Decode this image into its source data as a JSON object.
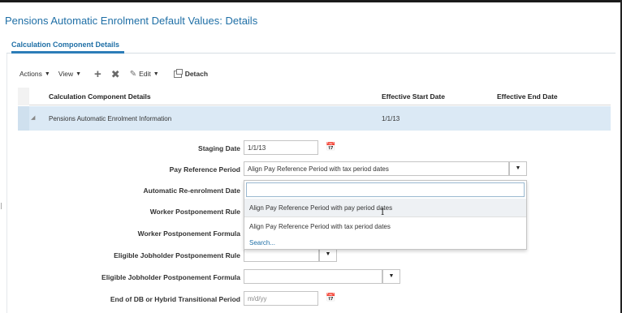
{
  "page": {
    "title": "Pensions Automatic Enrolment Default Values: Details"
  },
  "tabs": [
    {
      "label": "Calculation Component Details",
      "selected": true
    }
  ],
  "toolbar": {
    "actions_label": "Actions",
    "view_label": "View",
    "add_icon": "plus-icon",
    "delete_icon": "x-icon",
    "edit_label": "Edit",
    "detach_label": "Detach"
  },
  "table": {
    "columns": [
      "Calculation Component Details",
      "Effective Start Date",
      "Effective End Date"
    ],
    "rows": [
      {
        "name": "Pensions Automatic Enrolment Information",
        "start": "1/1/13",
        "end": ""
      }
    ]
  },
  "form": {
    "staging_date": {
      "label": "Staging Date",
      "value": "1/1/13"
    },
    "pay_reference_period": {
      "label": "Pay Reference Period",
      "value": "Align Pay Reference Period with tax period dates"
    },
    "auto_reenrolment_date": {
      "label": "Automatic Re-enrolment Date"
    },
    "worker_postponement_rule": {
      "label": "Worker Postponement Rule"
    },
    "worker_postponement_formula": {
      "label": "Worker Postponement Formula"
    },
    "eligible_jobholder_postponement_rule": {
      "label": "Eligible Jobholder Postponement Rule"
    },
    "eligible_jobholder_postponement_formula": {
      "label": "Eligible Jobholder Postponement Formula"
    },
    "end_of_db_hybrid_period": {
      "label": "End of DB or Hybrid Transitional Period",
      "placeholder": "m/d/yy"
    }
  },
  "dropdown": {
    "options": [
      "Align Pay Reference Period with pay period dates",
      "Align Pay Reference Period with tax period dates"
    ],
    "search_label": "Search..."
  },
  "colors": {
    "accent": "#1f6fa6",
    "selected_row": "#dbe9f5"
  }
}
